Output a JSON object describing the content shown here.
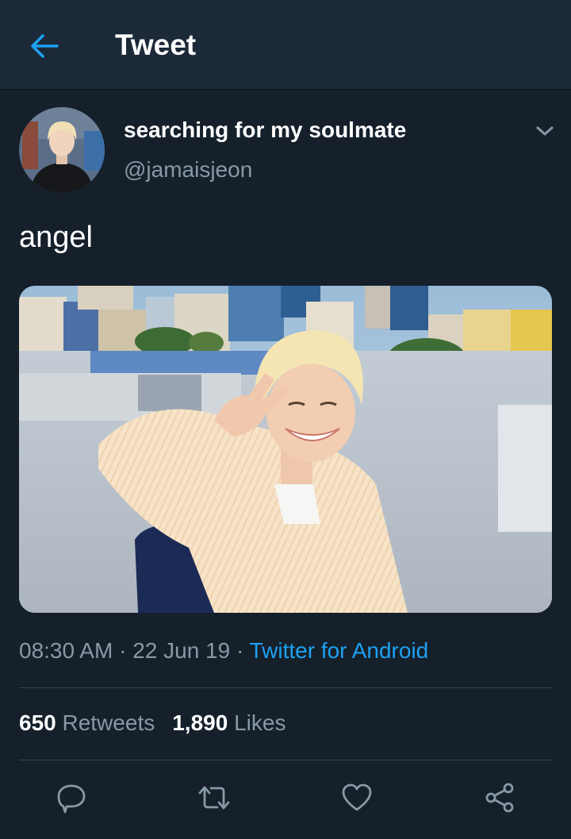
{
  "header": {
    "title": "Tweet",
    "back_icon": "arrow-left-icon"
  },
  "colors": {
    "background": "#15202b",
    "header": "#1c2938",
    "accent": "#1da1f2",
    "muted": "#8899a6",
    "divider": "#38444d"
  },
  "tweet": {
    "display_name": "searching for my soulmate",
    "handle": "@jamaisjeon",
    "text": "angel",
    "time": "08:30 AM",
    "date": "22 Jun 19",
    "separator": "·",
    "source": "Twitter for Android",
    "retweets_count": "650",
    "retweets_label": "Retweets",
    "likes_count": "1,890",
    "likes_label": "Likes"
  },
  "actions": [
    "reply-icon",
    "retweet-icon",
    "like-icon",
    "share-icon"
  ]
}
